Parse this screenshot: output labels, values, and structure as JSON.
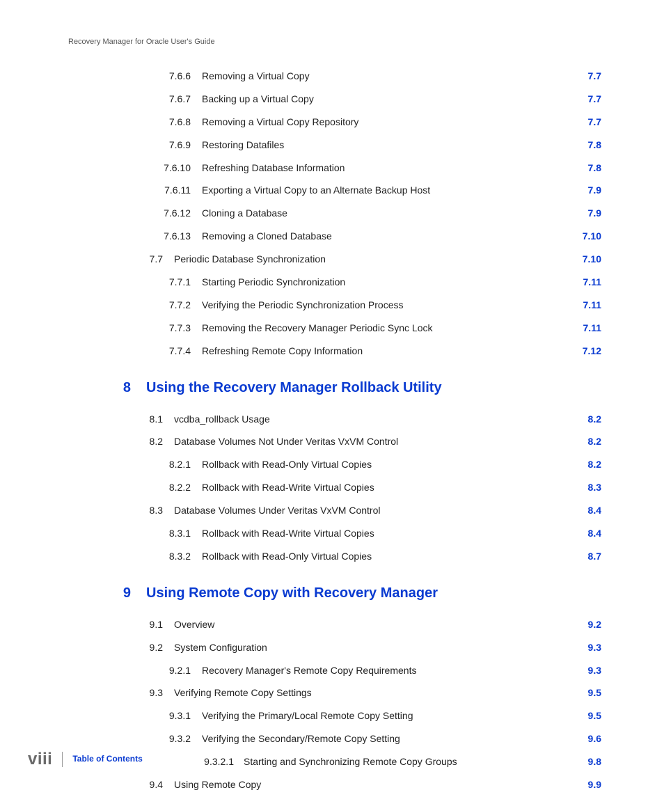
{
  "header": {
    "running_title": "Recovery Manager for Oracle User's Guide"
  },
  "toc": {
    "entries": [
      {
        "level": 1,
        "num": "7.6.6",
        "title": "Removing a Virtual Copy",
        "page": "7.7"
      },
      {
        "level": 1,
        "num": "7.6.7",
        "title": "Backing up a Virtual Copy",
        "page": "7.7"
      },
      {
        "level": 1,
        "num": "7.6.8",
        "title": "Removing a Virtual Copy Repository",
        "page": "7.7"
      },
      {
        "level": 1,
        "num": "7.6.9",
        "title": "Restoring Datafiles",
        "page": "7.8"
      },
      {
        "level": 1,
        "num": "7.6.10",
        "title": "Refreshing Database Information",
        "page": "7.8"
      },
      {
        "level": 1,
        "num": "7.6.11",
        "title": "Exporting a Virtual Copy to an Alternate Backup Host",
        "page": "7.9"
      },
      {
        "level": 1,
        "num": "7.6.12",
        "title": "Cloning a Database",
        "page": "7.9"
      },
      {
        "level": 1,
        "num": "7.6.13",
        "title": "Removing a Cloned Database",
        "page": "7.10"
      },
      {
        "level": 0,
        "num": "7.7",
        "title": "Periodic Database Synchronization",
        "page": "7.10"
      },
      {
        "level": 1,
        "num": "7.7.1",
        "title": "Starting Periodic Synchronization",
        "page": "7.11"
      },
      {
        "level": 1,
        "num": "7.7.2",
        "title": "Verifying the Periodic Synchronization Process",
        "page": "7.11"
      },
      {
        "level": 1,
        "num": "7.7.3",
        "title": "Removing the Recovery Manager Periodic Sync Lock",
        "page": "7.11"
      },
      {
        "level": 1,
        "num": "7.7.4",
        "title": "Refreshing Remote Copy Information",
        "page": "7.12"
      },
      {
        "type": "chapter",
        "num": "8",
        "title": "Using the Recovery Manager Rollback Utility"
      },
      {
        "level": 0,
        "num": "8.1",
        "title": "vcdba_rollback Usage",
        "page": "8.2"
      },
      {
        "level": 0,
        "num": "8.2",
        "title": "Database Volumes Not Under Veritas VxVM Control",
        "page": "8.2"
      },
      {
        "level": 1,
        "num": "8.2.1",
        "title": "Rollback with Read-Only Virtual Copies",
        "page": "8.2"
      },
      {
        "level": 1,
        "num": "8.2.2",
        "title": "Rollback with Read-Write Virtual Copies",
        "page": "8.3"
      },
      {
        "level": 0,
        "num": "8.3",
        "title": "Database Volumes Under Veritas VxVM Control",
        "page": "8.4"
      },
      {
        "level": 1,
        "num": "8.3.1",
        "title": "Rollback with Read-Write Virtual Copies",
        "page": "8.4"
      },
      {
        "level": 1,
        "num": "8.3.2",
        "title": "Rollback with Read-Only Virtual Copies",
        "page": "8.7"
      },
      {
        "type": "chapter",
        "num": "9",
        "title": "Using Remote Copy with Recovery Manager"
      },
      {
        "level": 0,
        "num": "9.1",
        "title": "Overview",
        "page": "9.2"
      },
      {
        "level": 0,
        "num": "9.2",
        "title": "System Configuration",
        "page": "9.3"
      },
      {
        "level": 1,
        "num": "9.2.1",
        "title": "Recovery Manager's Remote Copy Requirements",
        "page": "9.3"
      },
      {
        "level": 0,
        "num": "9.3",
        "title": "Verifying Remote Copy Settings",
        "page": "9.5"
      },
      {
        "level": 1,
        "num": "9.3.1",
        "title": "Verifying the Primary/Local Remote Copy Setting",
        "page": "9.5"
      },
      {
        "level": 1,
        "num": "9.3.2",
        "title": "Verifying the Secondary/Remote Copy Setting",
        "page": "9.6"
      },
      {
        "level": 2,
        "num": "9.3.2.1",
        "title": "Starting and Synchronizing Remote Copy Groups",
        "page": "9.8"
      },
      {
        "level": 0,
        "num": "9.4",
        "title": "Using Remote Copy",
        "page": "9.9"
      }
    ]
  },
  "footer": {
    "folio": "viii",
    "label": "Table of Contents"
  }
}
